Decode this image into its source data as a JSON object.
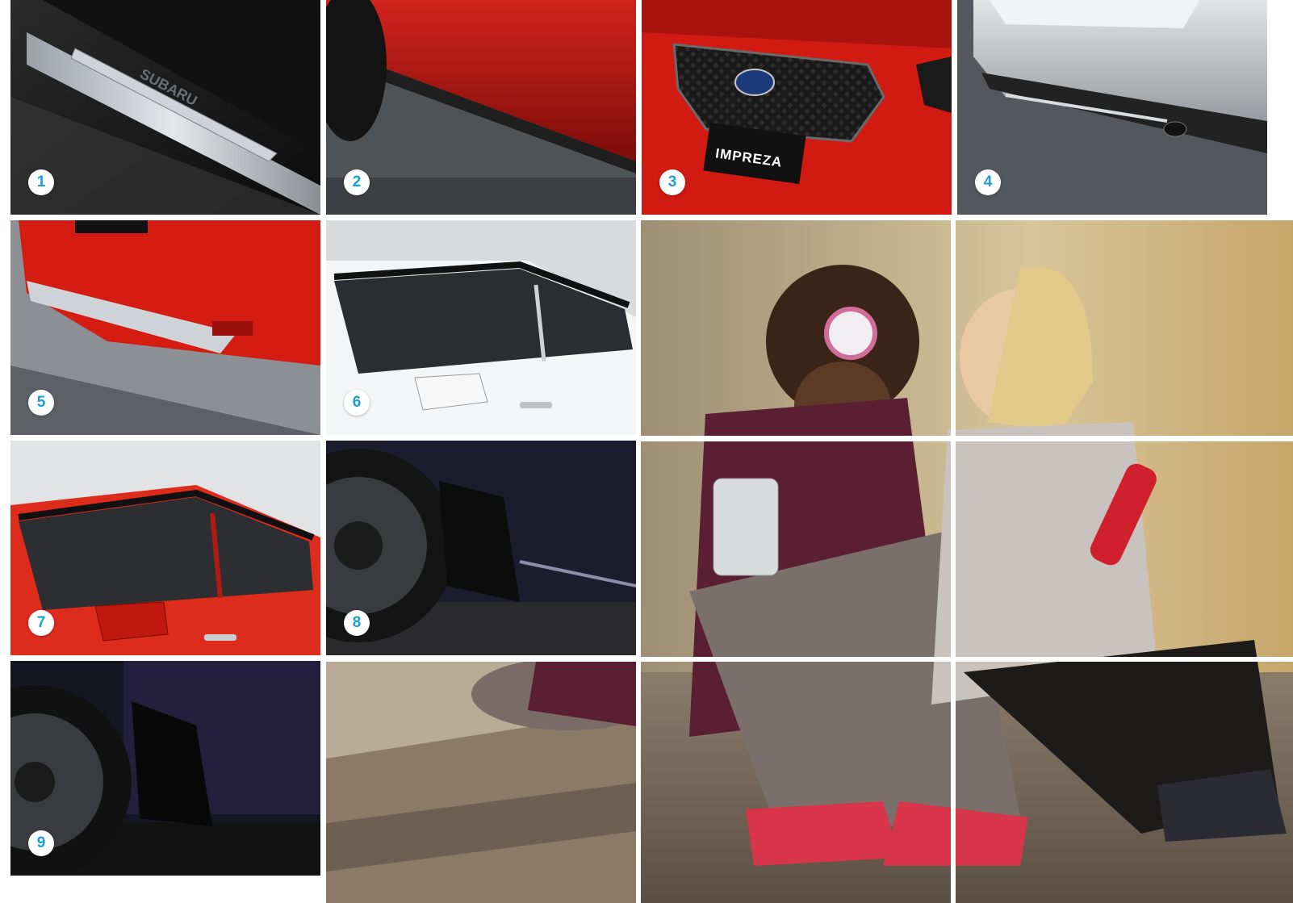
{
  "tiles": [
    {
      "number": "1",
      "subject": "door-sill-plate",
      "bg": "#1a1a1a",
      "accent": "#c9cdd2"
    },
    {
      "number": "2",
      "subject": "side-skirt",
      "bg": "#b3120f",
      "accent": "#2a2a2a"
    },
    {
      "number": "3",
      "subject": "front-grille",
      "bg": "#d61a14",
      "accent": "#1b1b1b"
    },
    {
      "number": "4",
      "subject": "rear-bumper-silver",
      "bg": "#b9bcc0",
      "accent": "#2d2d2d"
    },
    {
      "number": "5",
      "subject": "rear-skirt-red",
      "bg": "#cf1a12",
      "accent": "#c8cbd0"
    },
    {
      "number": "6",
      "subject": "weather-visor-white",
      "bg": "#e8eaec",
      "accent": "#2b2b2b"
    },
    {
      "number": "7",
      "subject": "weather-visor-red",
      "bg": "#d92a1c",
      "accent": "#2a2a2a"
    },
    {
      "number": "8",
      "subject": "mud-guard-front",
      "bg": "#1b1a2c",
      "accent": "#0d0d0d"
    },
    {
      "number": "9",
      "subject": "mud-guard-rear",
      "bg": "#141420",
      "accent": "#0a0a0a"
    }
  ],
  "badge_color": "#1a9fd9",
  "grille_text": "IMPREZA",
  "sill_text": "SUBARU"
}
